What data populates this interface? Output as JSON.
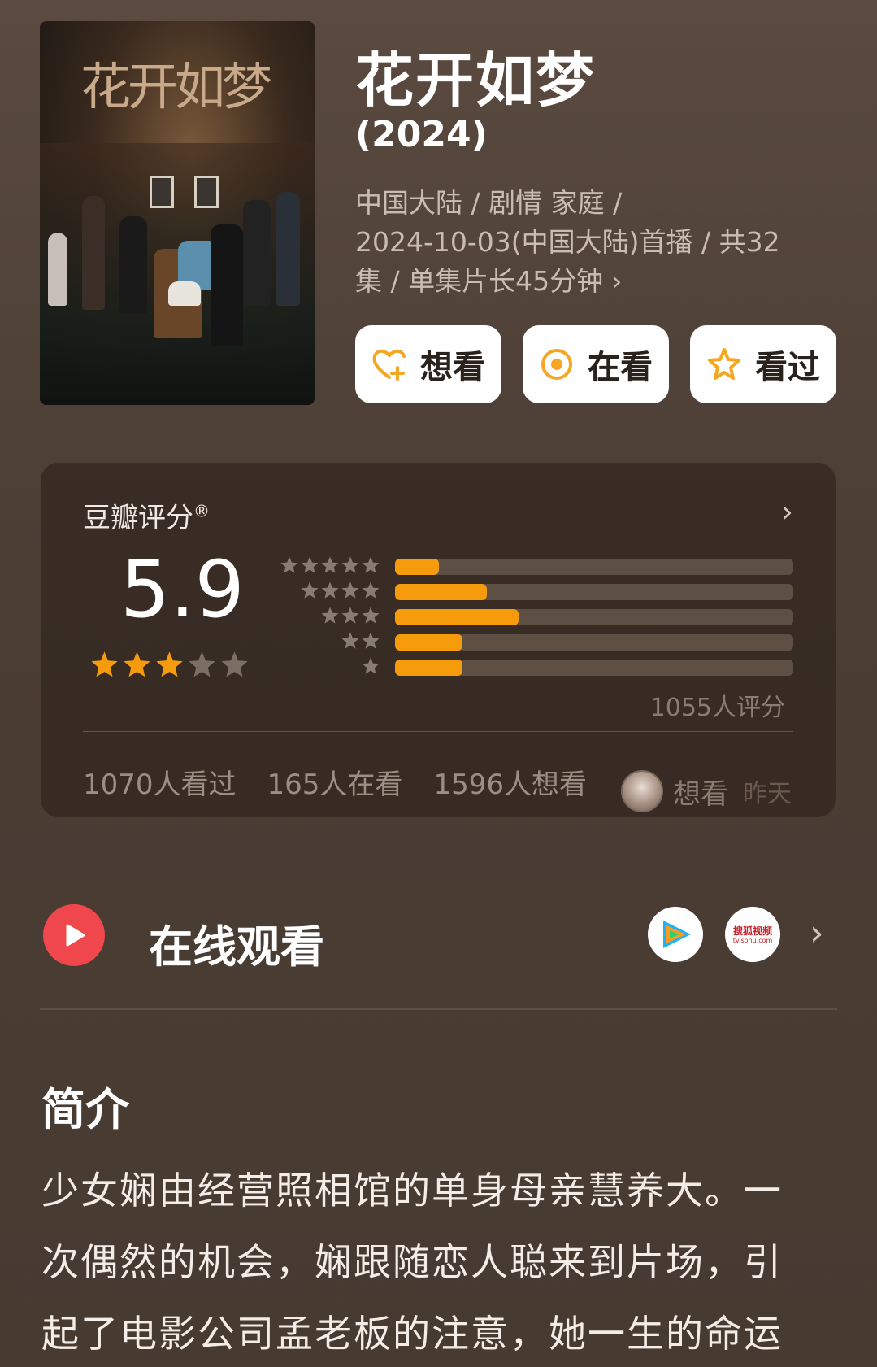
{
  "poster": {
    "title_art": "花开如梦"
  },
  "header": {
    "title": "花开如梦",
    "year": "(2024)",
    "meta_line1": "中国大陆 / 剧情 家庭 /",
    "meta_line2": "2024-10-03(中国大陆)首播 / 共32",
    "meta_line3": "集 / 单集片长45分钟",
    "meta_chevron": "›"
  },
  "actions": {
    "want_label": "想看",
    "watching_label": "在看",
    "watched_label": "看过"
  },
  "rating": {
    "label": "豆瓣评分",
    "label_mark": "®",
    "chevron": "›",
    "score": "5.9",
    "stars_filled": 3,
    "stars_total": 5,
    "distribution": [
      {
        "stars": 5,
        "percent": 11
      },
      {
        "stars": 4,
        "percent": 23
      },
      {
        "stars": 3,
        "percent": 31
      },
      {
        "stars": 2,
        "percent": 17
      },
      {
        "stars": 1,
        "percent": 17
      }
    ],
    "count_text": "1055人评分",
    "stats": {
      "watched": "1070人看过",
      "watching": "165人在看",
      "want": "1596人想看"
    },
    "friend": {
      "action": "想看",
      "time": "昨天"
    }
  },
  "watch_online": {
    "label": "在线观看",
    "platforms": [
      {
        "icon": "tencent-video-icon"
      },
      {
        "icon": "sohu-video-icon",
        "text": "搜狐视频",
        "subtext": "tv.sohu.com"
      }
    ],
    "chevron": "›"
  },
  "intro": {
    "title": "简介",
    "line1": "少女娴由经营照相馆的单身母亲慧养大。一",
    "line2": "次偶然的机会，娴跟随恋人聪来到片场，引",
    "line3": "起了电影公司孟老板的注意，她一生的命运"
  },
  "colors": {
    "accent": "#f59b0c",
    "play_red": "#f0474c",
    "background": "#4c3e35"
  }
}
